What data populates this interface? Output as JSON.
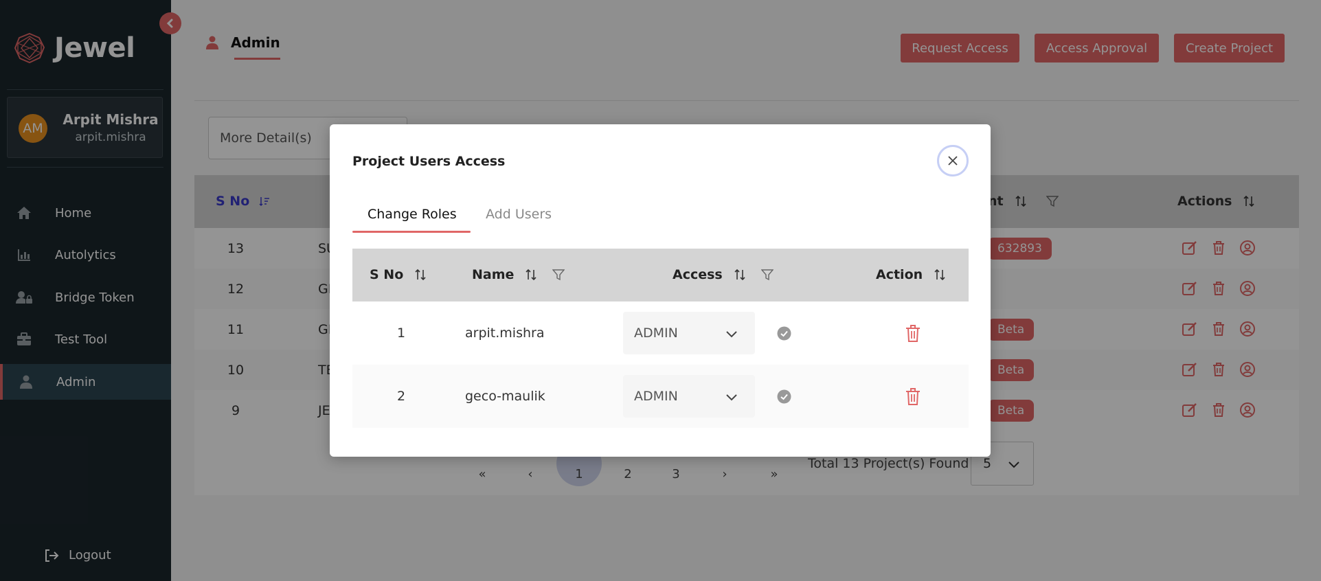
{
  "app": {
    "brand": "Jewel"
  },
  "user": {
    "initials": "AM",
    "name": "Arpit Mishra",
    "handle": "arpit.mishra"
  },
  "nav": [
    {
      "label": "Home",
      "icon": "home-icon"
    },
    {
      "label": "Autolytics",
      "icon": "bar-chart-icon"
    },
    {
      "label": "Bridge Token",
      "icon": "user-lock-icon"
    },
    {
      "label": "Test Tool",
      "icon": "toolbox-icon"
    },
    {
      "label": "Admin",
      "icon": "user-icon",
      "active": true
    }
  ],
  "logout": "Logout",
  "page": {
    "title": "Admin",
    "buttons": {
      "request_access": "Request Access",
      "access_approval": "Access Approval",
      "create_project": "Create Project"
    },
    "more_details_placeholder": "More Detail(s)"
  },
  "main_table": {
    "headers": {
      "sno": "S No",
      "env_partial": "nt",
      "actions": "Actions"
    },
    "rows": [
      {
        "sno": "13",
        "name": "SU",
        "badge": "632893"
      },
      {
        "sno": "12",
        "name": "GE",
        "badge": ""
      },
      {
        "sno": "11",
        "name": "GE",
        "badge": "Beta"
      },
      {
        "sno": "10",
        "name": "TE",
        "badge": "Beta"
      },
      {
        "sno": "9",
        "name": "JE",
        "badge": "Beta"
      }
    ]
  },
  "pagination": {
    "pages": [
      "1",
      "2",
      "3"
    ],
    "first": "«",
    "prev": "‹",
    "next": "›",
    "last": "»",
    "total_text": "Total 13 Project(s) Found",
    "page_size": "5"
  },
  "modal": {
    "title": "Project Users Access",
    "tabs": [
      "Change Roles",
      "Add Users"
    ],
    "headers": {
      "sno": "S No",
      "name": "Name",
      "access": "Access",
      "action": "Action"
    },
    "rows": [
      {
        "sno": "1",
        "name": "arpit.mishra",
        "access": "ADMIN"
      },
      {
        "sno": "2",
        "name": "geco-maulik",
        "access": "ADMIN"
      }
    ]
  },
  "colors": {
    "accent": "#e06666",
    "sidebar": "#1b262c",
    "active_nav": "#2c4552",
    "header_bg": "#d4d4d4"
  }
}
